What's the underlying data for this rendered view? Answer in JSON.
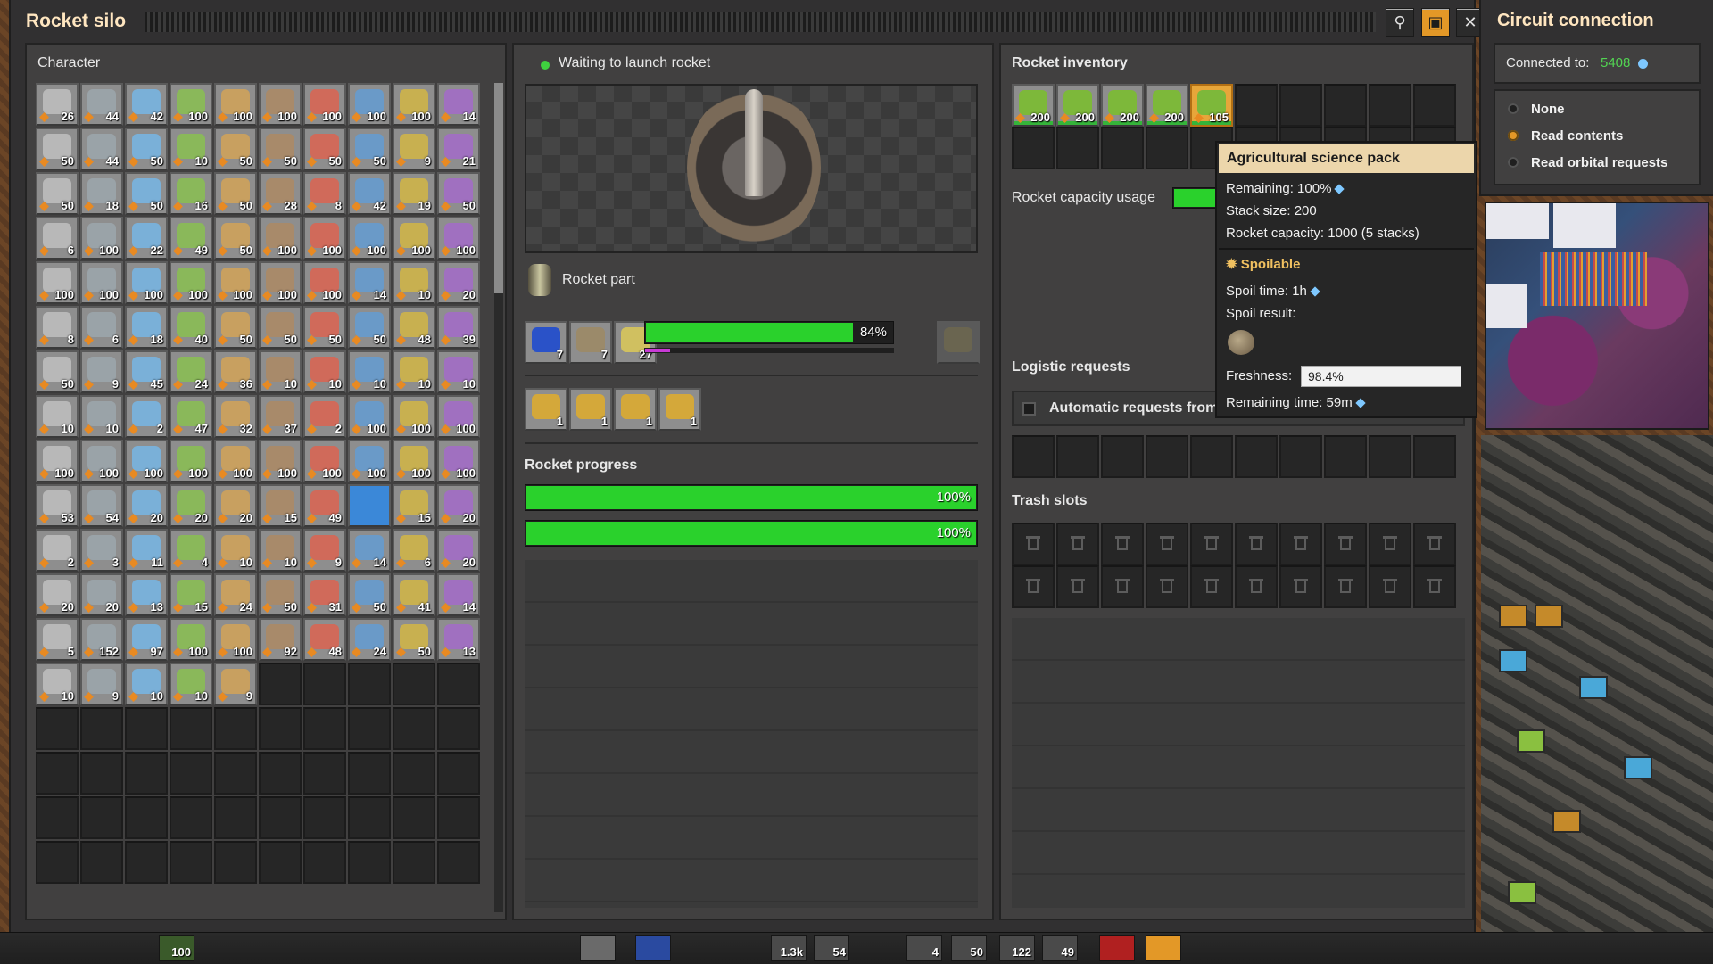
{
  "silo": {
    "title": "Rocket silo",
    "buttons": {
      "search": "search-icon",
      "tree": "circuit-network-icon",
      "close": "close-icon"
    }
  },
  "character": {
    "label": "Character",
    "rows": [
      [
        "26",
        "44",
        "42",
        "100",
        "100",
        "100",
        "100",
        "100",
        "100",
        "14"
      ],
      [
        "50",
        "44",
        "50",
        "10",
        "50",
        "50",
        "50",
        "50",
        "9",
        "21"
      ],
      [
        "50",
        "18",
        "50",
        "16",
        "50",
        "28",
        "8",
        "42",
        "19",
        "50"
      ],
      [
        "6",
        "100",
        "22",
        "49",
        "50",
        "100",
        "100",
        "100",
        "100",
        "100"
      ],
      [
        "100",
        "100",
        "100",
        "100",
        "100",
        "100",
        "100",
        "14",
        "10",
        "20"
      ],
      [
        "8",
        "6",
        "18",
        "40",
        "50",
        "50",
        "50",
        "50",
        "48",
        "39"
      ],
      [
        "50",
        "9",
        "45",
        "24",
        "36",
        "10",
        "10",
        "10",
        "10",
        "10"
      ],
      [
        "10",
        "10",
        "2",
        "47",
        "32",
        "37",
        "2",
        "100",
        "100",
        "100"
      ],
      [
        "100",
        "100",
        "100",
        "100",
        "100",
        "100",
        "100",
        "100",
        "100",
        "100"
      ],
      [
        "53",
        "54",
        "20",
        "20",
        "20",
        "15",
        "49",
        "",
        "15",
        "20"
      ],
      [
        "2",
        "3",
        "11",
        "4",
        "10",
        "10",
        "9",
        "14",
        "6",
        "20"
      ],
      [
        "20",
        "20",
        "13",
        "15",
        "24",
        "50",
        "31",
        "50",
        "41",
        "14"
      ],
      [
        "5",
        "152",
        "97",
        "100",
        "100",
        "92",
        "48",
        "24",
        "50",
        "13"
      ],
      [
        "10",
        "9",
        "10",
        "10",
        "9",
        "",
        "",
        "",
        "",
        ""
      ]
    ]
  },
  "status": {
    "text": "Waiting to launch rocket",
    "color": "#3fd13f"
  },
  "recipe": {
    "label": "Rocket part",
    "ingredients": [
      "7",
      "7",
      "27"
    ],
    "progress_percent": 84,
    "progress_label": "84%",
    "bonus_fraction": 0.1,
    "result_slots": [
      "1",
      "1",
      "1",
      "1"
    ]
  },
  "rocket_progress": {
    "label": "Rocket progress",
    "bars": [
      {
        "value": 100,
        "label": "100%"
      },
      {
        "value": 100,
        "label": "100%"
      }
    ]
  },
  "rocket_inventory": {
    "label": "Rocket inventory",
    "slots": [
      "200",
      "200",
      "200",
      "200",
      "105",
      "",
      "",
      "",
      "",
      ""
    ],
    "capacity_label": "Rocket capacity usage",
    "capacity_fraction": 0.66
  },
  "logistic": {
    "label": "Logistic requests",
    "auto_label": "Automatic requests from"
  },
  "trash": {
    "label": "Trash slots"
  },
  "tooltip": {
    "title": "Agricultural science pack",
    "remaining": "Remaining: 100%",
    "stack_size": "Stack size: 200",
    "rocket_capacity": "Rocket capacity: 1000 (5 stacks)",
    "spoilable": "Spoilable",
    "spoil_time": "Spoil time: 1h",
    "spoil_result": "Spoil result:",
    "freshness_label": "Freshness:",
    "freshness_value": "98.4%",
    "remaining_time": "Remaining time: 59m"
  },
  "circuit": {
    "title": "Circuit connection",
    "connected_label": "Connected to:",
    "connected_id": "5408",
    "options": [
      {
        "label": "None",
        "selected": false
      },
      {
        "label": "Read contents",
        "selected": true
      },
      {
        "label": "Read orbital requests",
        "selected": false
      }
    ]
  },
  "hotbar": {
    "slots": [
      "100",
      "1.3k",
      "54",
      "4",
      "50",
      "122",
      "49"
    ]
  },
  "colors": {
    "accent": "#e39827",
    "progress_green": "#2ad12c",
    "title_text": "#ffe6c0",
    "connected_id": "#52d452"
  }
}
